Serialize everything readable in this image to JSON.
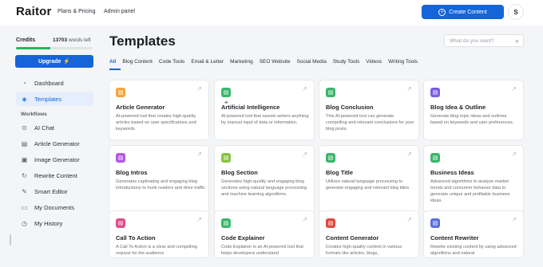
{
  "header": {
    "logo": "aitor",
    "logo_mark": "R",
    "nav": [
      "Plans & Pricing",
      "Admin panel"
    ],
    "create_button": "Create Content",
    "avatar_initial": "S"
  },
  "sidebar": {
    "credits_label": "Credits",
    "credits_value": "13703",
    "credits_unit": "words left",
    "credits_fraction": 0.45,
    "upgrade_label": "Upgrade",
    "upgrade_icon": "bolt-icon",
    "items_top": [
      {
        "label": "Dashboard",
        "icon": "dashboard-icon"
      },
      {
        "label": "Templates",
        "icon": "layers-icon",
        "active": true
      }
    ],
    "workflows_label": "Workflows",
    "items": [
      {
        "label": "AI Chat",
        "icon": "chat-icon"
      },
      {
        "label": "Article Generator",
        "icon": "article-icon"
      },
      {
        "label": "Image Generator",
        "icon": "image-icon"
      },
      {
        "label": "Rewrite Content",
        "icon": "refresh-icon"
      },
      {
        "label": "Smart Editor",
        "icon": "edit-icon"
      },
      {
        "label": "My Documents",
        "icon": "folder-icon"
      },
      {
        "label": "My History",
        "icon": "history-icon"
      }
    ]
  },
  "main": {
    "title": "Templates",
    "search_placeholder": "What do you want?",
    "tabs": [
      "All",
      "Blog Content",
      "Code Tools",
      "Email & Letter",
      "Marketing",
      "SEO Website",
      "Social Media",
      "Study Tools",
      "Videos",
      "Writing Tools"
    ],
    "cards": [
      {
        "title": "Article Generator",
        "desc": "AI-powered tool that creates high-quality articles based on user specifications and keywords.",
        "color": "#f0a63a"
      },
      {
        "title": "Artificial Intelligence",
        "desc": "AI-powered tool that assists writers anything by manual input of data or information.",
        "color": "#3ab66b"
      },
      {
        "title": "Blog Conclusion",
        "desc": "This AI-powered tool can generate compelling and relevant conclusions for your blog posts.",
        "color": "#3ab66b"
      },
      {
        "title": "Blog Idea & Outline",
        "desc": "Generate blog topic ideas and outlines based on keywords and user preferences.",
        "color": "#7b5ce0"
      },
      {
        "title": "Blog Intros",
        "desc": "Generates captivating and engaging blog introductions to hook readers and drive traffic",
        "color": "#b456e0"
      },
      {
        "title": "Blog Section",
        "desc": "Generates high-quality and engaging blog sections using natural language processing and machine learning algorithms.",
        "color": "#88c23e"
      },
      {
        "title": "Blog Title",
        "desc": "Utilizes natural language processing to generate engaging and relevant blog titles",
        "color": "#3ab66b"
      },
      {
        "title": "Business Ideas",
        "desc": "Advanced algorithms to analyze market trends and consumer behavior data to generate unique and profitable business ideas.",
        "color": "#3ab66b"
      },
      {
        "title": "Call To Action",
        "desc": "A Call To Action is a clear and compelling request for the audience",
        "color": "#e04a8a"
      },
      {
        "title": "Code Explainer",
        "desc": "Code Explainer is an AI-powered tool that helps developers understand",
        "color": "#3ab66b"
      },
      {
        "title": "Content Generator",
        "desc": "Creates high-quality content in various formats like articles, blogs,",
        "color": "#e0493c"
      },
      {
        "title": "Content Rewriter",
        "desc": "Rewrite existing content by using advanced algorithms and natural",
        "color": "#5b6ee0"
      }
    ]
  },
  "colors": {
    "accent": "#1565d8",
    "credits_bar": "#26b467"
  }
}
